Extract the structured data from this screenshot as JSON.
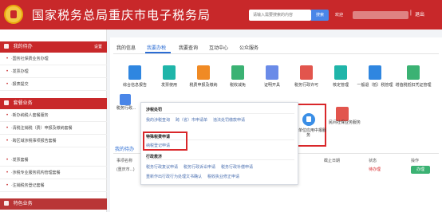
{
  "header": {
    "title": "国家税务总局重庆市电子税务局",
    "search_placeholder": "请输入需要搜索的内容",
    "search_button": "搜索",
    "welcome": "欢迎",
    "separator": "|",
    "logout": "退出",
    "brand_color": "#c8282a"
  },
  "sidebar": {
    "section1": {
      "label": "我的待办",
      "right": "设置"
    },
    "section1_items": [
      "·国务社保费业务办理",
      "·发票办理",
      "·报表提交"
    ],
    "section2": {
      "label": "套餐业务"
    },
    "section2_items": [
      "·新办纳税人套餐服务",
      "·清税注销税（费）申报及缴纳套餐",
      "·跨区域涉税事项报告套餐",
      "·发票套餐",
      "·涉税专业服务机构管理套餐",
      "·注销税务登记套餐"
    ],
    "section3": {
      "label": "特色业务"
    }
  },
  "main": {
    "tabs": [
      "我的信息",
      "我要办税",
      "我要查询",
      "互动中心",
      "公众服务"
    ],
    "services": [
      {
        "label": "综合信息报告",
        "color": "#2f86e0"
      },
      {
        "label": "发票使用",
        "color": "#1fb5a9"
      },
      {
        "label": "税费申报及缴纳",
        "color": "#f08a24"
      },
      {
        "label": "税收减免",
        "color": "#3bb273"
      },
      {
        "label": "证明开具",
        "color": "#6a8be8"
      },
      {
        "label": "税务行政许可",
        "color": "#e2554d"
      },
      {
        "label": "核定管理",
        "color": "#1fb5a9"
      },
      {
        "label": "一般退（抵）税管理",
        "color": "#2f86e0"
      },
      {
        "label": "增值税抵扣凭证管理",
        "color": "#3bb273"
      }
    ],
    "left_service": "税务行政...",
    "highlight_service": "社保单位应用中报服务",
    "more_service": "民间社保业务服务",
    "section_title": "我的待办",
    "table": {
      "headers": [
        "事项名称",
        "截止日期",
        "状态",
        "操作"
      ],
      "row": {
        "name": "(重庆市...)",
        "status": "待办理",
        "action": "办理"
      }
    }
  },
  "dropdown": {
    "group1_title": "涉税处罚",
    "group1_items": [
      "我的涉税查询",
      "跨（省）市申请单",
      "违法处罚缴款申请"
    ],
    "group2_title": "特殊税费申请",
    "group2_items": [
      "纳税登记申请"
    ],
    "group3_title": "行政救济",
    "group3_items": [
      "税务行政复议申请",
      "税务行政诉讼申请",
      "税务行政补偿申请"
    ],
    "group3_items2": [
      "重新作出行政行为处理文书确认",
      "税收执业修正申请"
    ]
  }
}
